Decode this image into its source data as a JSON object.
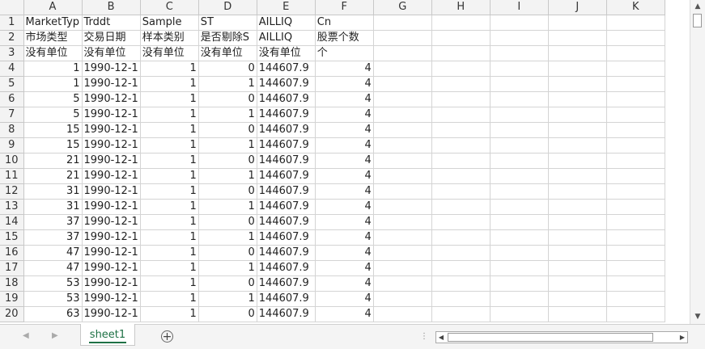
{
  "columns": [
    "A",
    "B",
    "C",
    "D",
    "E",
    "F",
    "G",
    "H",
    "I",
    "J",
    "K"
  ],
  "rows": [
    {
      "n": "1",
      "cells": [
        "MarketTyp",
        "Trddt",
        "Sample",
        "ST",
        "AILLIQ",
        "Cn"
      ]
    },
    {
      "n": "2",
      "cells": [
        "市场类型",
        "交易日期",
        "样本类别",
        "是否剔除S",
        "AILLIQ",
        "股票个数"
      ]
    },
    {
      "n": "3",
      "cells": [
        "没有单位",
        "没有单位",
        "没有单位",
        "没有单位",
        "没有单位",
        "个"
      ]
    },
    {
      "n": "4",
      "cells": [
        "1",
        "1990-12-1",
        "1",
        "0",
        "144607.9",
        "4"
      ]
    },
    {
      "n": "5",
      "cells": [
        "1",
        "1990-12-1",
        "1",
        "1",
        "144607.9",
        "4"
      ]
    },
    {
      "n": "6",
      "cells": [
        "5",
        "1990-12-1",
        "1",
        "0",
        "144607.9",
        "4"
      ]
    },
    {
      "n": "7",
      "cells": [
        "5",
        "1990-12-1",
        "1",
        "1",
        "144607.9",
        "4"
      ]
    },
    {
      "n": "8",
      "cells": [
        "15",
        "1990-12-1",
        "1",
        "0",
        "144607.9",
        "4"
      ]
    },
    {
      "n": "9",
      "cells": [
        "15",
        "1990-12-1",
        "1",
        "1",
        "144607.9",
        "4"
      ]
    },
    {
      "n": "10",
      "cells": [
        "21",
        "1990-12-1",
        "1",
        "0",
        "144607.9",
        "4"
      ]
    },
    {
      "n": "11",
      "cells": [
        "21",
        "1990-12-1",
        "1",
        "1",
        "144607.9",
        "4"
      ]
    },
    {
      "n": "12",
      "cells": [
        "31",
        "1990-12-1",
        "1",
        "0",
        "144607.9",
        "4"
      ]
    },
    {
      "n": "13",
      "cells": [
        "31",
        "1990-12-1",
        "1",
        "1",
        "144607.9",
        "4"
      ]
    },
    {
      "n": "14",
      "cells": [
        "37",
        "1990-12-1",
        "1",
        "0",
        "144607.9",
        "4"
      ]
    },
    {
      "n": "15",
      "cells": [
        "37",
        "1990-12-1",
        "1",
        "1",
        "144607.9",
        "4"
      ]
    },
    {
      "n": "16",
      "cells": [
        "47",
        "1990-12-1",
        "1",
        "0",
        "144607.9",
        "4"
      ]
    },
    {
      "n": "17",
      "cells": [
        "47",
        "1990-12-1",
        "1",
        "1",
        "144607.9",
        "4"
      ]
    },
    {
      "n": "18",
      "cells": [
        "53",
        "1990-12-1",
        "1",
        "0",
        "144607.9",
        "4"
      ]
    },
    {
      "n": "19",
      "cells": [
        "53",
        "1990-12-1",
        "1",
        "1",
        "144607.9",
        "4"
      ]
    },
    {
      "n": "20",
      "cells": [
        "63",
        "1990-12-1",
        "1",
        "0",
        "144607.9",
        "4"
      ]
    }
  ],
  "sheet_tab": "sheet1",
  "icons": {
    "add_sheet": "plus-circle-icon",
    "nav_prev": "triangle-left-icon",
    "nav_next": "triangle-right-icon",
    "scroll_up": "triangle-up-icon",
    "scroll_down": "triangle-down-icon",
    "splitter": "vertical-dots-icon"
  },
  "accent_color": "#1e7145"
}
